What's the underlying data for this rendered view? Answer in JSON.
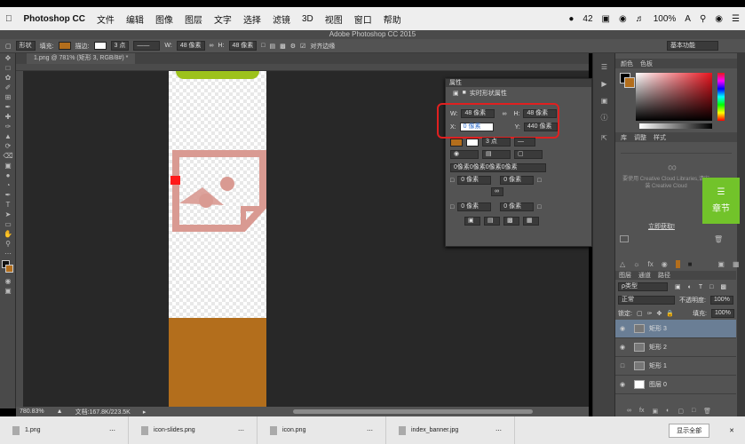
{
  "mac_menu": {
    "app": "Photoshop CC",
    "items": [
      "文件",
      "编辑",
      "图像",
      "图层",
      "文字",
      "选择",
      "滤镜",
      "3D",
      "视图",
      "窗口",
      "帮助"
    ],
    "status": {
      "battery_count": "42",
      "battery": "100%",
      "lang": "A"
    }
  },
  "window_title": "Adobe Photoshop CC 2015",
  "options": {
    "shape_mode": "形状",
    "fill_label": "填充:",
    "fill_color": "#b36e1c",
    "stroke_label": "描边:",
    "stroke_width": "3 点",
    "w_label": "W:",
    "w_value": "48 像素",
    "h_label": "H:",
    "h_value": "48 像素",
    "align_edges": "对齐边缘",
    "workspace": "基本功能"
  },
  "doc_tab": "1.png @ 781% (矩形 3, RGB/8#) *",
  "status": {
    "zoom": "780.83%",
    "doc_size": "文档:167.8K/223.5K"
  },
  "props": {
    "header": "属性",
    "title": "实时形状属性",
    "w_label": "W:",
    "w_value": "48 像素",
    "h_label": "H:",
    "h_value": "48 像素",
    "x_label": "X:",
    "x_value": "0 像素",
    "y_label": "Y:",
    "y_value": "440 像素",
    "stroke_width": "3 点",
    "corner_summary": "0像素0像素0像素0像素",
    "corner_tl": "0 像素",
    "corner_tr": "0 像素",
    "corner_bl": "0 像素",
    "corner_br": "0 像素"
  },
  "color_panel": {
    "tabs": [
      "颜色",
      "色板"
    ]
  },
  "adjust_panel": {
    "tabs": [
      "库",
      "调整",
      "样式"
    ]
  },
  "ccloud": {
    "text": "要使用 Creative Cloud Libraries,请安装 Creative Cloud",
    "link": "立即获取!"
  },
  "chapter_badge": "章节",
  "layers_panel": {
    "tabs": [
      "图层",
      "通道",
      "路径"
    ],
    "filter": "ρ类型",
    "blend": "正常",
    "opacity_label": "不透明度:",
    "opacity": "100%",
    "lock_label": "锁定:",
    "fill_label": "填充:",
    "fill": "100%",
    "layers": [
      {
        "name": "矩形 3",
        "selected": true
      },
      {
        "name": "矩形 2",
        "selected": false
      },
      {
        "name": "矩形 1",
        "selected": false
      },
      {
        "name": "图层 0",
        "selected": false
      }
    ]
  },
  "dock": {
    "files": [
      "1.png",
      "icon-slides.png",
      "icon.png",
      "index_banner.jpg"
    ],
    "show_all": "显示全部"
  }
}
